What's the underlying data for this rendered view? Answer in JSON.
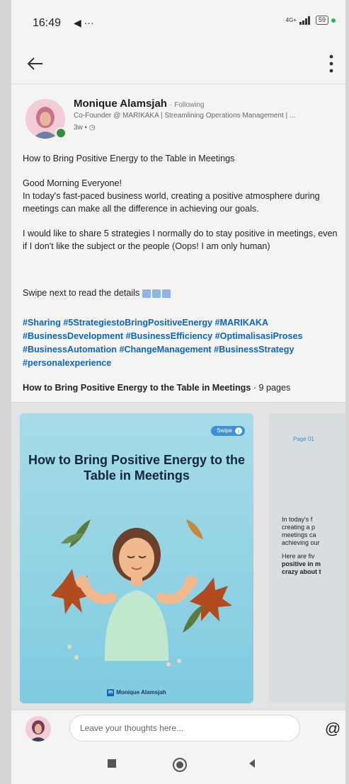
{
  "status_bar": {
    "time": "16:49",
    "extra_icons": "◀ ···",
    "network": "4G+",
    "battery": "59"
  },
  "post": {
    "author_name": "Monique Alamsjah",
    "follow_status": "· Following",
    "headline": "Co-Founder @ MARIKAKA | Streamlining Operations Management | ...",
    "time_ago": "3w • ◷",
    "title_line": "How to Bring Positive Energy to the Table in Meetings",
    "greeting": "Good Morning Everyone!",
    "paragraph1": "In today's fast-paced business world, creating a positive atmosphere during meetings can make all the difference in achieving our goals.",
    "paragraph2": "I would like to share 5 strategies I normally do to stay positive in meetings, even if I don't like the subject or the people (Oops! I am only human)",
    "swipe_text": "Swipe next to read the details",
    "hashtags": "#Sharing #5StrategiestoBringPositiveEnergy #MARIKAKA #BusinessDevelopment #BusinessEfficiency #OptimalisasiProses #BusinessAutomation #ChangeManagement #BusinessStrategy #personalexperience"
  },
  "document": {
    "title": "How to Bring Positive Energy to the Table in Meetings",
    "pages": " · 9 pages",
    "card1": {
      "swipe_label": "Swipe",
      "title": "How to Bring Positive Energy to the Table in Meetings",
      "author": "Monique Alamsjah",
      "li_badge": "in"
    },
    "card2": {
      "page_label": "Page 01",
      "line1": "In today's f",
      "line2": "creating a p",
      "line3": "meetings ca",
      "line4": "achieving our",
      "line5": "Here are fiv",
      "line6": "positive in m",
      "line7": "crazy about t"
    }
  },
  "comment": {
    "placeholder": "Leave your thoughts here...",
    "at_symbol": "@"
  },
  "colors": {
    "link_blue": "#0a66c2",
    "card_teal": "#8fd3e3"
  }
}
